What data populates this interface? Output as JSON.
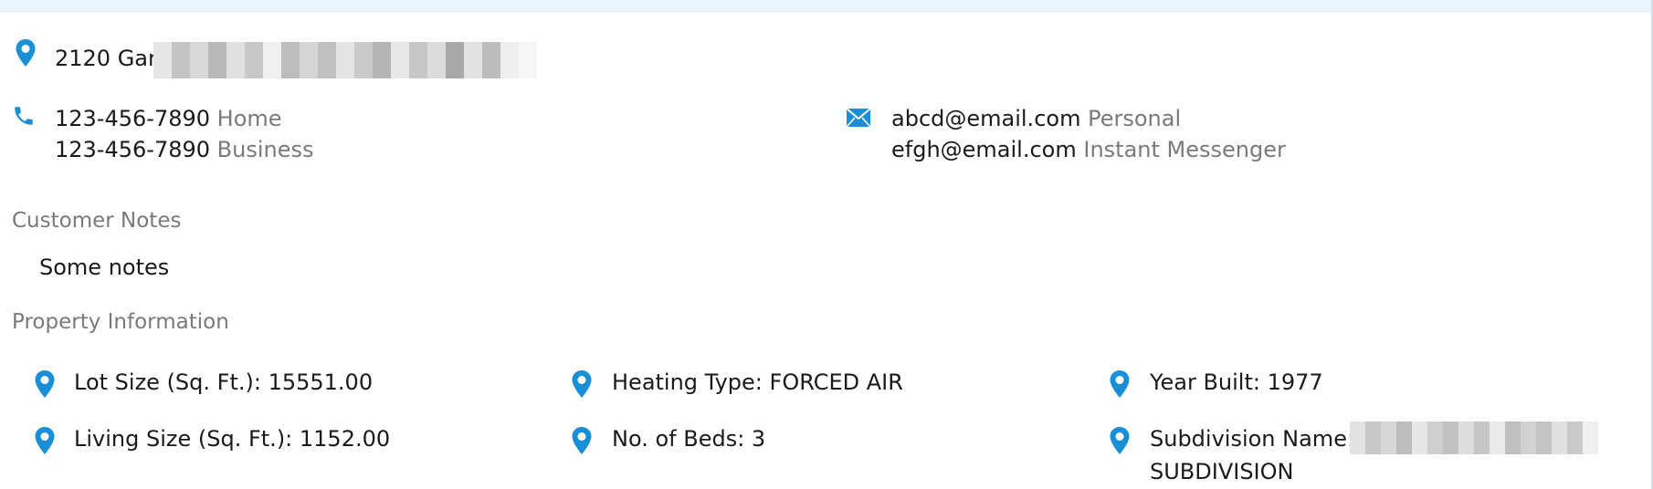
{
  "address": {
    "icon": "map-pin-icon",
    "visible_text": "2120 Gar",
    "redacted": true
  },
  "phones": {
    "icon": "phone-icon",
    "items": [
      {
        "number": "123-456-7890",
        "type": "Home"
      },
      {
        "number": "123-456-7890",
        "type": "Business"
      }
    ]
  },
  "emails": {
    "icon": "envelope-icon",
    "items": [
      {
        "address": "abcd@email.com",
        "type": "Personal"
      },
      {
        "address": "efgh@email.com",
        "type": "Instant Messenger"
      }
    ]
  },
  "customer_notes": {
    "label": "Customer Notes",
    "text": "Some notes"
  },
  "property_information": {
    "label": "Property Information",
    "items": [
      {
        "text": "Lot Size (Sq. Ft.): 15551.00",
        "icon": "map-pin-icon"
      },
      {
        "text": "Heating Type: FORCED AIR",
        "icon": "map-pin-icon"
      },
      {
        "text": "Year Built: 1977",
        "icon": "map-pin-icon"
      },
      {
        "text": "Living Size (Sq. Ft.): 1152.00",
        "icon": "map-pin-icon"
      },
      {
        "text": "No. of Beds: 3",
        "icon": "map-pin-icon"
      },
      {
        "text": "Subdivision Name:",
        "icon": "map-pin-icon",
        "continuation": "SUBDIVISION",
        "redacted": true
      }
    ]
  },
  "colors": {
    "accent": "#1a8fd6",
    "muted_text": "#7a7a7a",
    "top_strip": "#eaf4fc"
  }
}
